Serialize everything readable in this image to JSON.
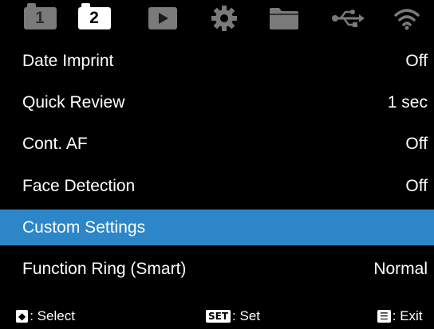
{
  "tabs": [
    {
      "label": "1",
      "icon": "menu-page-1-icon",
      "active": false
    },
    {
      "label": "2",
      "icon": "menu-page-2-icon",
      "active": true
    },
    {
      "icon": "playback-icon"
    },
    {
      "icon": "settings-gear-icon"
    },
    {
      "icon": "folder-icon"
    },
    {
      "icon": "usb-icon"
    },
    {
      "icon": "wifi-icon"
    }
  ],
  "menu": {
    "items": [
      {
        "label": "Date Imprint",
        "value": "Off"
      },
      {
        "label": "Quick Review",
        "value": "1 sec"
      },
      {
        "label": "Cont. AF",
        "value": "Off"
      },
      {
        "label": "Face Detection",
        "value": "Off"
      },
      {
        "label": "Custom Settings",
        "value": "",
        "selected": true
      },
      {
        "label": "Function Ring (Smart)",
        "value": "Normal"
      }
    ]
  },
  "footer": {
    "select": {
      "key": "◆",
      "label": ": Select"
    },
    "set": {
      "key": "SET",
      "label": ": Set"
    },
    "exit": {
      "key": "☰",
      "label": ": Exit"
    }
  },
  "colors": {
    "selection": "#2d86c8",
    "active_tab": "#ffffff",
    "inactive_tab": "#7a7a7a"
  }
}
